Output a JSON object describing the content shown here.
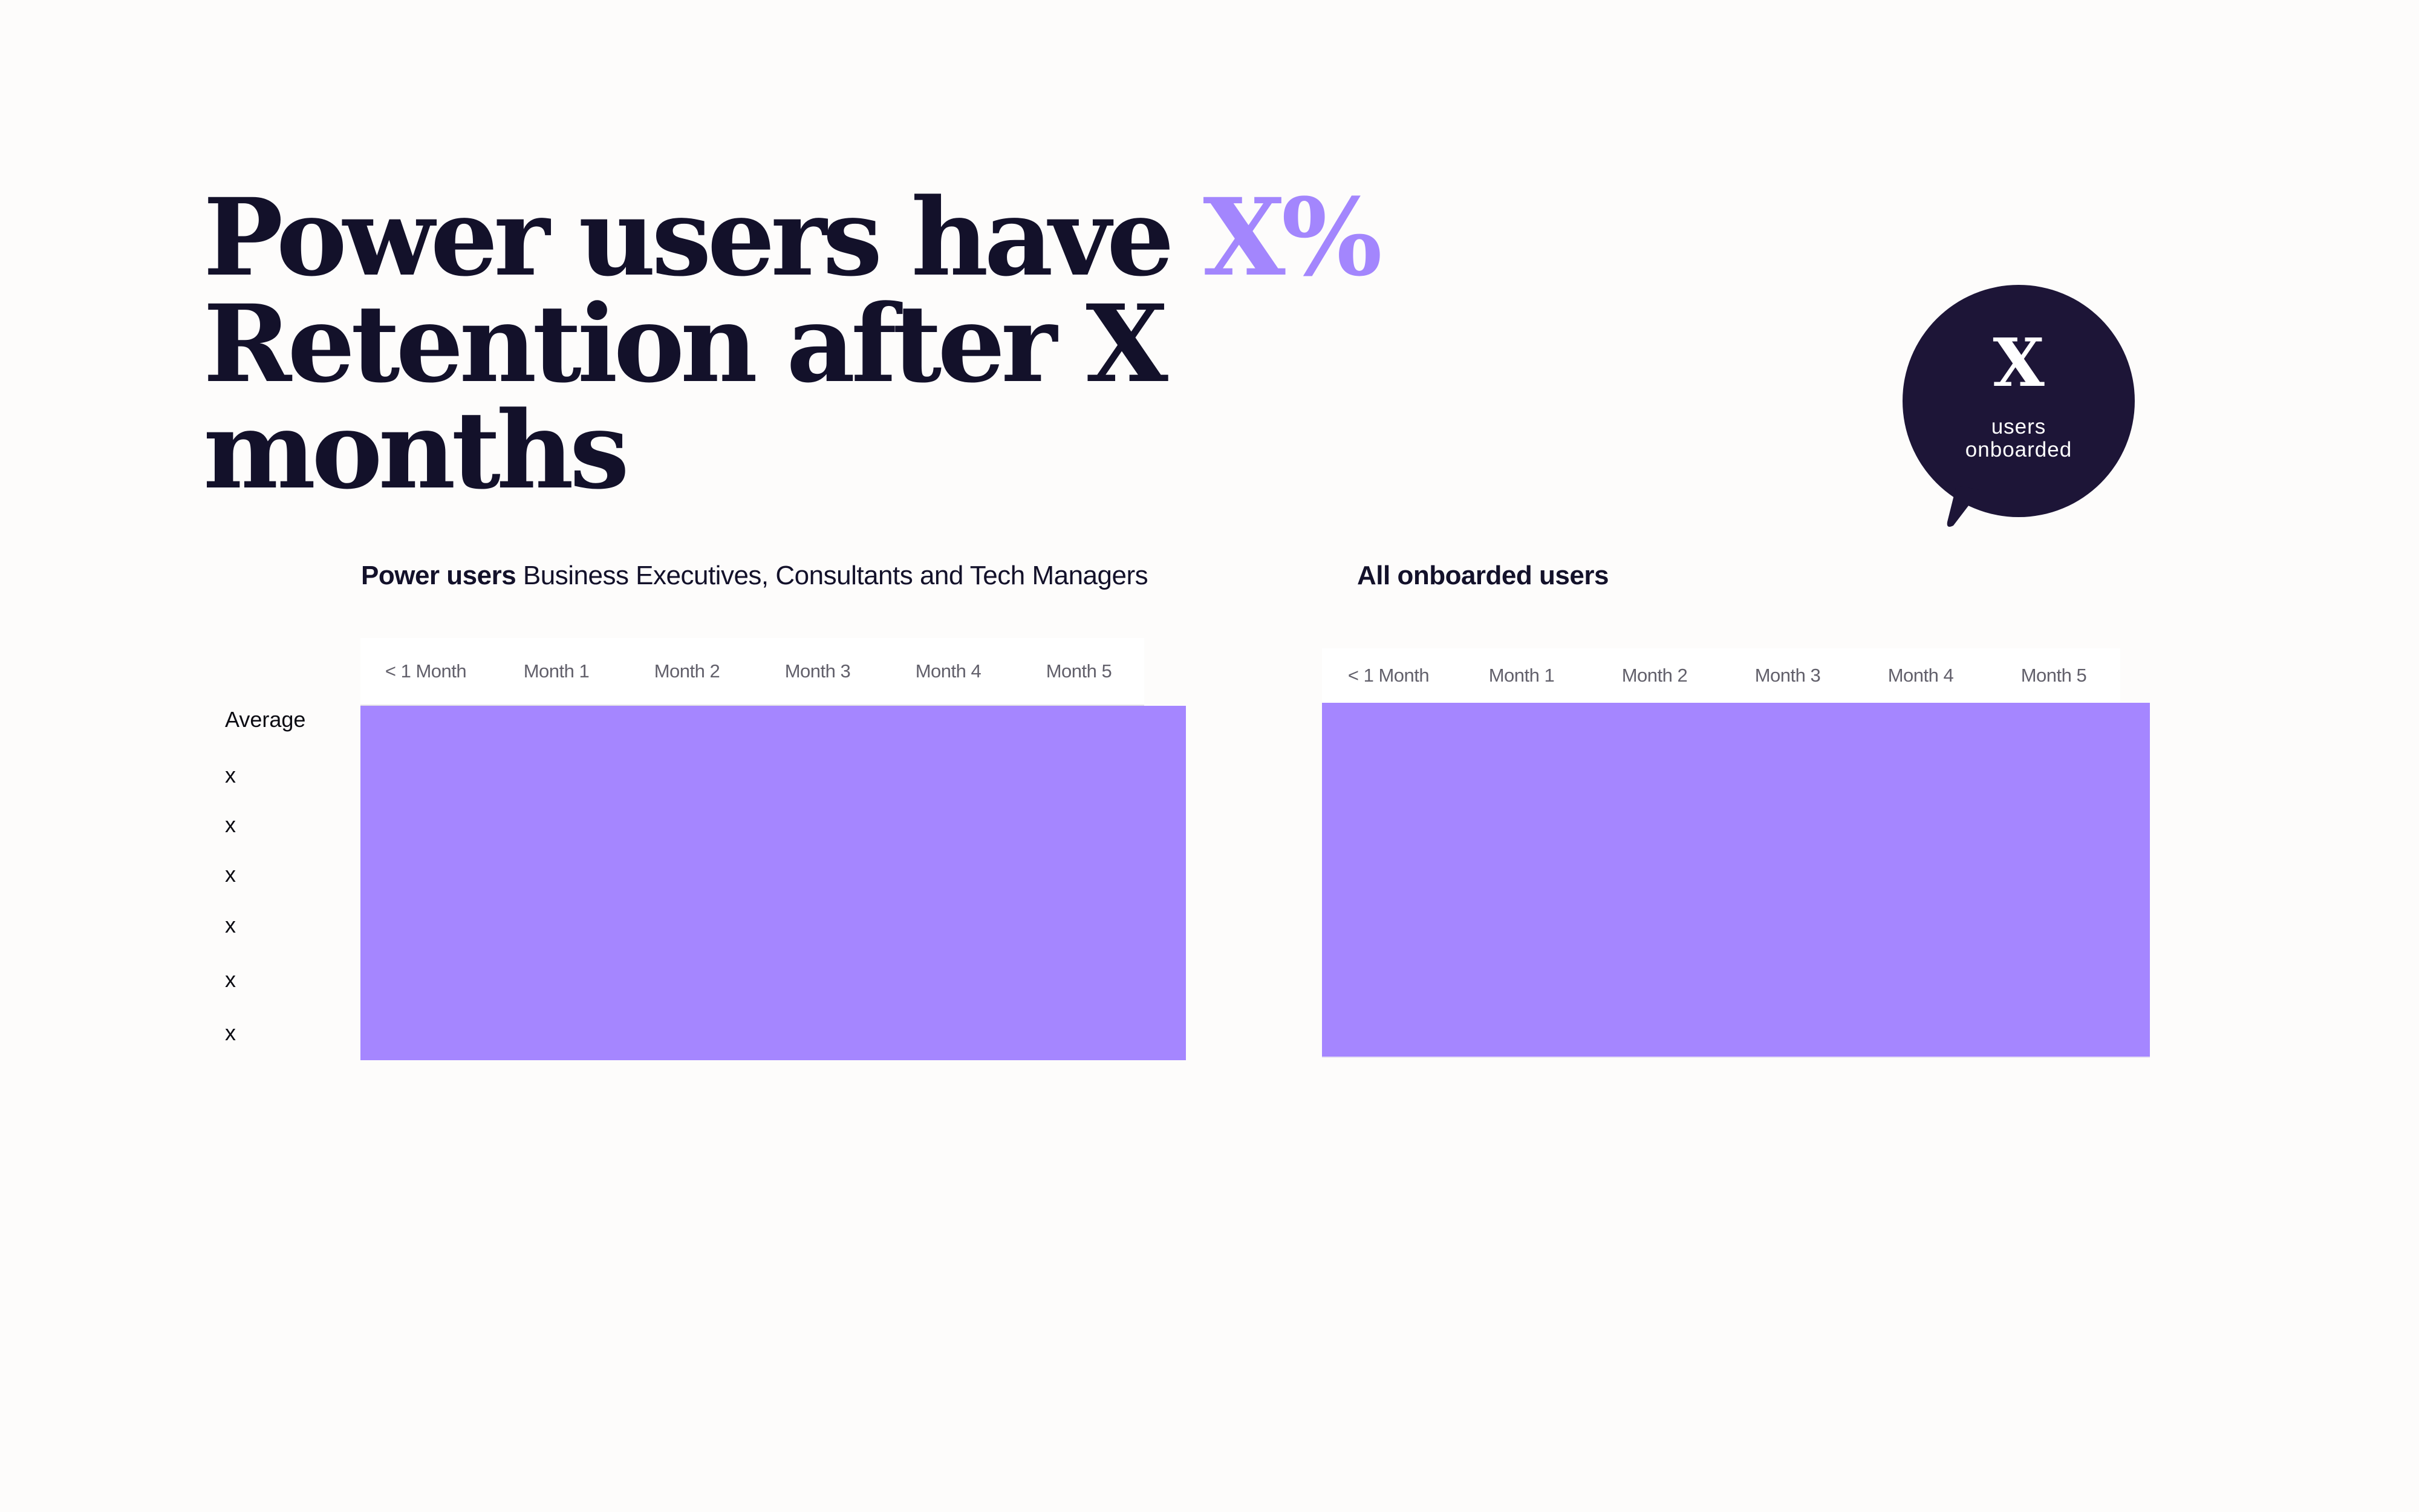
{
  "headline": {
    "line1_prefix": "Power users have ",
    "line1_accent": "X%",
    "line2": "Retention after X",
    "line3": "months"
  },
  "colors": {
    "ink": "#13112a",
    "accent": "#a386fd",
    "cohort_fill": "#a586ff",
    "bubble": "#1d1537",
    "background": "#fdfcfb"
  },
  "bubble": {
    "value": "X",
    "caption_line1": "users",
    "caption_line2": "onboarded"
  },
  "power_users_table": {
    "label_strong": "Power users",
    "label_rest": " Business Executives, Consultants and Tech Managers",
    "columns": [
      "< 1 Month",
      "Month 1",
      "Month 2",
      "Month 3",
      "Month 4",
      "Month 5"
    ]
  },
  "all_users_table": {
    "label_strong": "All onboarded users",
    "columns": [
      "< 1 Month",
      "Month 1",
      "Month 2",
      "Month 3",
      "Month 4",
      "Month 5"
    ]
  },
  "row_labels": [
    "Average",
    "x",
    "x",
    "x",
    "x",
    "x",
    "x"
  ]
}
